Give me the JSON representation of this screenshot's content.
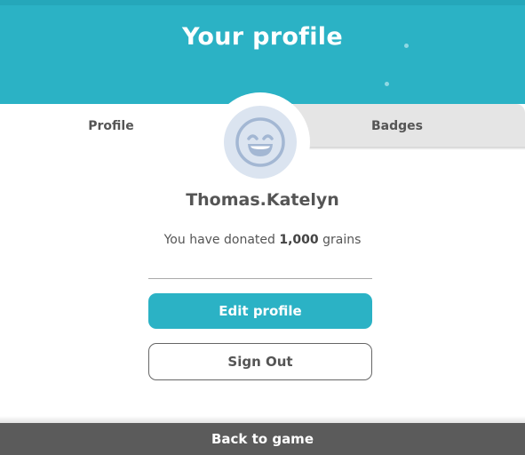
{
  "header": {
    "title": "Your profile",
    "color": "#2bb2c5"
  },
  "tabs": [
    {
      "label": "Profile",
      "active": true
    },
    {
      "label": "Badges",
      "active": false
    }
  ],
  "profile": {
    "avatar_icon": "grinning-face-icon",
    "username": "Thomas.Katelyn",
    "donation_prefix": "You have donated",
    "donation_amount": "1,000",
    "donation_unit": "grains"
  },
  "actions": {
    "edit_label": "Edit profile",
    "signout_label": "Sign Out"
  },
  "footer": {
    "back_label": "Back to game"
  }
}
